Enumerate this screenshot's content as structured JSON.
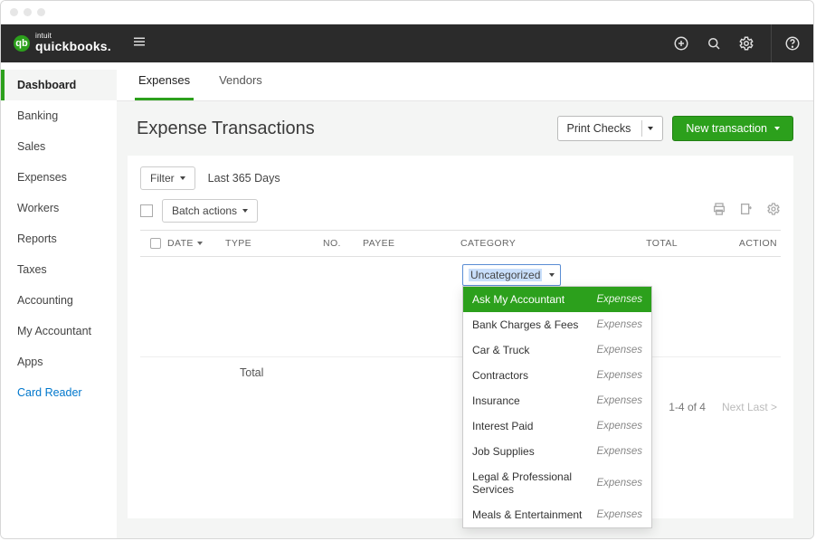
{
  "brand": {
    "intuit": "intuit",
    "name": "quickbooks."
  },
  "sidebar": {
    "items": [
      {
        "label": "Dashboard",
        "active": true
      },
      {
        "label": "Banking"
      },
      {
        "label": "Sales"
      },
      {
        "label": "Expenses"
      },
      {
        "label": "Workers"
      },
      {
        "label": "Reports"
      },
      {
        "label": "Taxes"
      },
      {
        "label": "Accounting"
      },
      {
        "label": "My Accountant"
      },
      {
        "label": "Apps"
      },
      {
        "label": "Card Reader",
        "link": true
      }
    ]
  },
  "tabs": [
    {
      "label": "Expenses",
      "active": true
    },
    {
      "label": "Vendors"
    }
  ],
  "page": {
    "title": "Expense Transactions"
  },
  "header_actions": {
    "print_checks": "Print Checks",
    "new_transaction": "New transaction"
  },
  "filter": {
    "button": "Filter",
    "range": "Last 365 Days",
    "batch": "Batch actions"
  },
  "columns": {
    "date": "DATE",
    "type": "TYPE",
    "no": "NO.",
    "payee": "PAYEE",
    "category": "CATEGORY",
    "total": "TOTAL",
    "action": "ACTION"
  },
  "category_select": {
    "value": "Uncategorized"
  },
  "dropdown": {
    "items": [
      {
        "label": "Ask My Accountant",
        "type": "Expenses",
        "highlight": true
      },
      {
        "label": "Bank Charges & Fees",
        "type": "Expenses"
      },
      {
        "label": "Car & Truck",
        "type": "Expenses"
      },
      {
        "label": "Contractors",
        "type": "Expenses"
      },
      {
        "label": "Insurance",
        "type": "Expenses"
      },
      {
        "label": "Interest Paid",
        "type": "Expenses"
      },
      {
        "label": "Job Supplies",
        "type": "Expenses"
      },
      {
        "label": "Legal & Professional Services",
        "type": "Expenses"
      },
      {
        "label": "Meals & Entertainment",
        "type": "Expenses"
      }
    ]
  },
  "total_row": {
    "label": "Total"
  },
  "footer": {
    "range": "1-4 of 4",
    "next": "Next Last >"
  }
}
